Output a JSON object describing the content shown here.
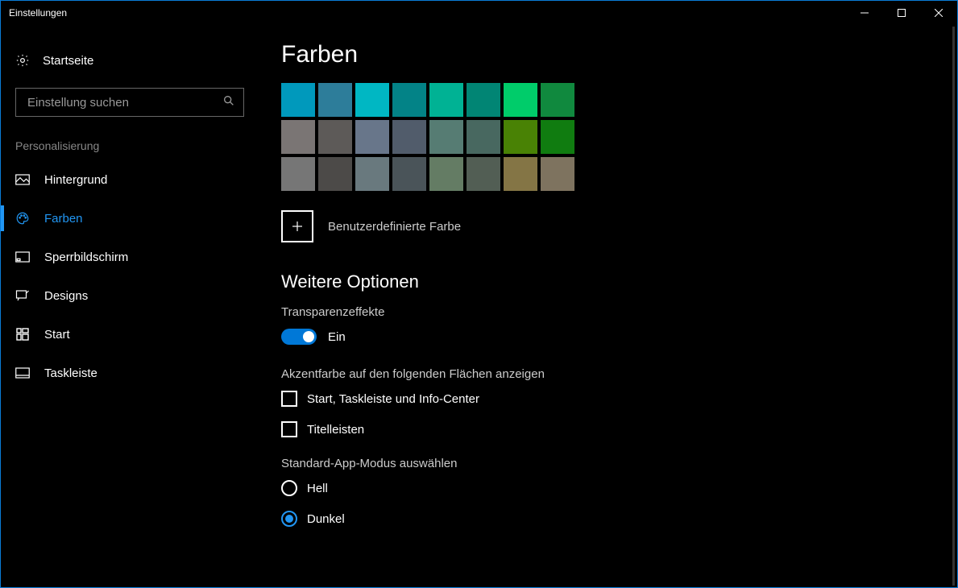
{
  "window": {
    "title": "Einstellungen"
  },
  "sidebar": {
    "home_label": "Startseite",
    "search_placeholder": "Einstellung suchen",
    "section_label": "Personalisierung",
    "items": [
      {
        "label": "Hintergrund"
      },
      {
        "label": "Farben"
      },
      {
        "label": "Sperrbildschirm"
      },
      {
        "label": "Designs"
      },
      {
        "label": "Start"
      },
      {
        "label": "Taskleiste"
      }
    ]
  },
  "main": {
    "title": "Farben",
    "custom_color_label": "Benutzerdefinierte Farbe",
    "more_options_title": "Weitere Optionen",
    "transparency_label": "Transparenzeffekte",
    "transparency_state": "Ein",
    "accent_surfaces_label": "Akzentfarbe auf den folgenden Flächen anzeigen",
    "cb_start_label": "Start, Taskleiste und Info-Center",
    "cb_titlebars_label": "Titelleisten",
    "app_mode_label": "Standard-App-Modus auswählen",
    "radio_light_label": "Hell",
    "radio_dark_label": "Dunkel",
    "swatches": [
      [
        "#0099bc",
        "#2d7d9a",
        "#00b7c3",
        "#038387",
        "#00b294",
        "#018574",
        "#00cc6a",
        "#10893e"
      ],
      [
        "#7a7574",
        "#5d5a58",
        "#68768a",
        "#515c6b",
        "#567c73",
        "#486860",
        "#498205",
        "#107c10"
      ],
      [
        "#767676",
        "#4c4a48",
        "#69797e",
        "#4a5459",
        "#647c64",
        "#525e54",
        "#847545",
        "#7e735f"
      ]
    ]
  }
}
